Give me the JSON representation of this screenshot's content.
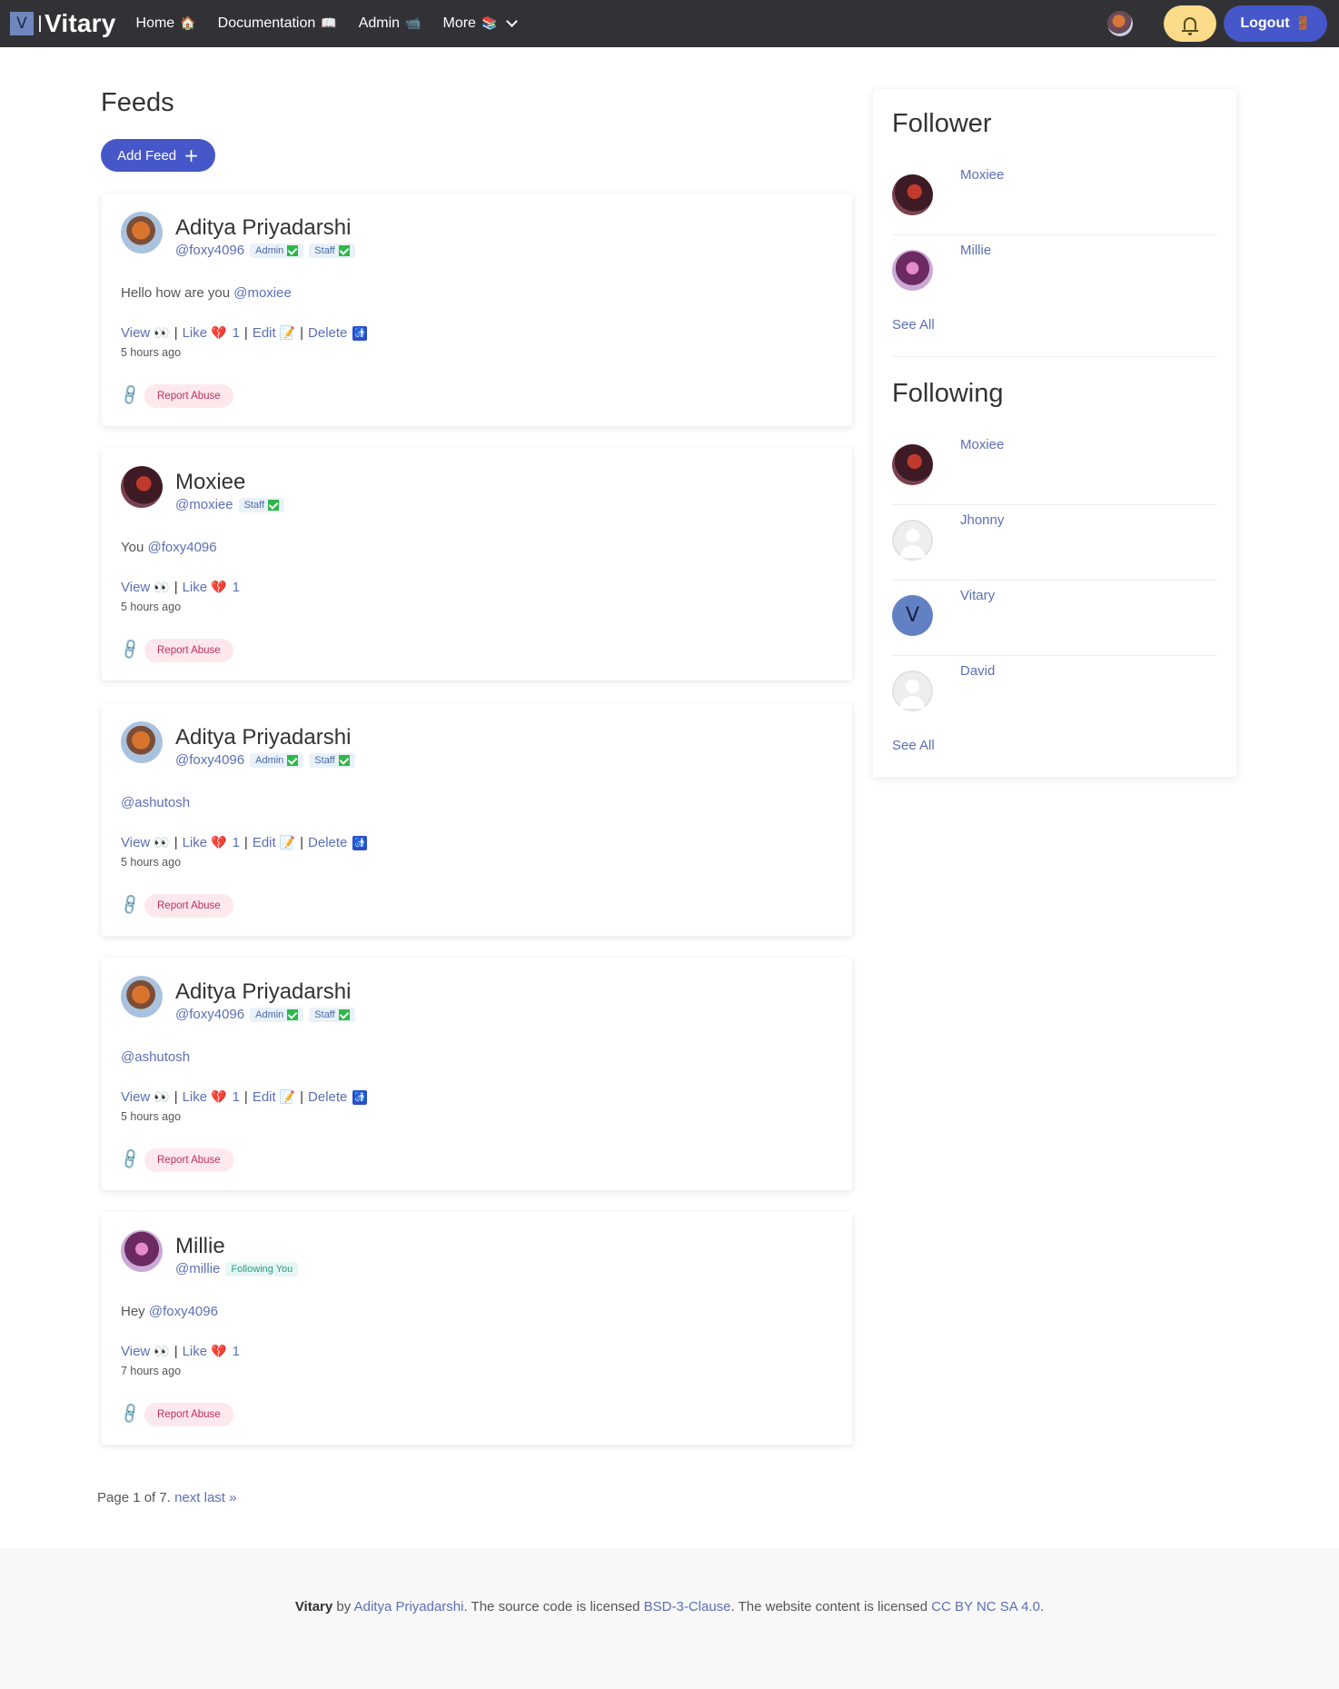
{
  "nav": {
    "brand_letter": "V",
    "brand_name": "Vitary",
    "links": [
      {
        "label": "Home",
        "icon": "🏠"
      },
      {
        "label": "Documentation",
        "icon": "📖"
      },
      {
        "label": "Admin",
        "icon": "📹"
      },
      {
        "label": "More",
        "icon": "📚"
      }
    ],
    "logout_label": "Logout",
    "logout_icon": "🚪"
  },
  "main": {
    "title": "Feeds",
    "add_feed_label": "Add Feed",
    "add_feed_icon": "+"
  },
  "feeds": [
    {
      "author": "Aditya Priyadarshi",
      "handle": "@foxy4096",
      "badges": [
        "Admin",
        "Staff"
      ],
      "text": "Hello how are you ",
      "mention": "@moxiee",
      "view": "View",
      "like": "Like",
      "likes": "1",
      "edit": "Edit",
      "delete": "Delete",
      "time": "5 hours ago",
      "report": "Report Abuse"
    },
    {
      "author": "Moxiee",
      "handle": "@moxiee",
      "badges": [
        "Staff"
      ],
      "text": "You ",
      "mention": "@foxy4096",
      "view": "View",
      "like": "Like",
      "likes": "1",
      "time": "5 hours ago",
      "report": "Report Abuse"
    },
    {
      "author": "Aditya Priyadarshi",
      "handle": "@foxy4096",
      "badges": [
        "Admin",
        "Staff"
      ],
      "text": "",
      "mention": "@ashutosh",
      "view": "View",
      "like": "Like",
      "likes": "1",
      "edit": "Edit",
      "delete": "Delete",
      "time": "5 hours ago",
      "report": "Report Abuse"
    },
    {
      "author": "Aditya Priyadarshi",
      "handle": "@foxy4096",
      "badges": [
        "Admin",
        "Staff"
      ],
      "text": "",
      "mention": "@ashutosh",
      "view": "View",
      "like": "Like",
      "likes": "1",
      "edit": "Edit",
      "delete": "Delete",
      "time": "5 hours ago",
      "report": "Report Abuse"
    },
    {
      "author": "Millie",
      "handle": "@millie",
      "badges": [
        "Following You"
      ],
      "text": "Hey ",
      "mention": "@foxy4096",
      "view": "View",
      "like": "Like",
      "likes": "1",
      "time": "7 hours ago",
      "report": "Report Abuse"
    }
  ],
  "pagination": {
    "text": "Page 1 of 7.",
    "next": "next",
    "last": "last »"
  },
  "sidebar": {
    "follower_title": "Follower",
    "followers": [
      "Moxiee",
      "Millie"
    ],
    "following_title": "Following",
    "following": [
      "Moxiee",
      "Jhonny",
      "Vitary",
      "David"
    ],
    "vitary_letter": "V",
    "see_all": "See All"
  },
  "footer": {
    "brand": "Vitary",
    "by": " by ",
    "author": "Aditya Priyadarshi",
    "mid": ". The source code is licensed ",
    "code_license": "BSD-3-Clause",
    "mid2": ". The website content is licensed ",
    "content_license": "CC BY NC SA 4.0",
    "end": "."
  },
  "icons": {
    "view": "👀",
    "like": "💔",
    "edit": "📝",
    "delete": "🚮",
    "link": "🔗",
    "bell": "bell-icon",
    "check": "check-icon"
  },
  "colors": {
    "navbar": "#323236",
    "accent": "#4557c9",
    "link": "#5c6fb5",
    "bell_button": "#fcdc8a",
    "report_bg": "#fde8ed"
  }
}
